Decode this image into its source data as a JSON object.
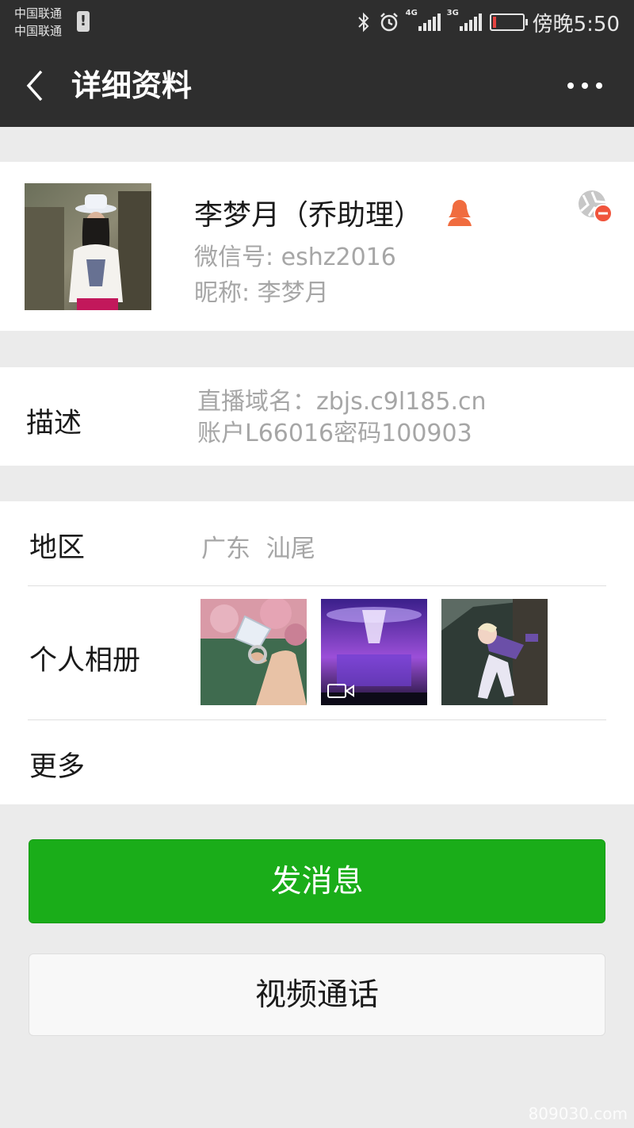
{
  "status_bar": {
    "carrier_1": "中国联通",
    "carrier_2": "中国联通",
    "signal_tag_1": "4G",
    "signal_tag_2": "3G",
    "time": "傍晚5:50",
    "battery_fraction": 0.1,
    "battery_color": "#e64340"
  },
  "nav": {
    "title": "详细资料",
    "back_icon": "chevron-left-icon",
    "more_icon": "more-dots-icon"
  },
  "profile": {
    "name": "李梦月（乔助理）",
    "wechat_id": "微信号: eshz2016",
    "nickname": "昵称: 李梦月",
    "gender_icon": "female-person-icon",
    "gender_icon_color": "#f06c3f",
    "privacy_icon": "hide-moments-icon"
  },
  "description": {
    "label": "描述",
    "line1": "直播域名：zbjs.c9l185.cn",
    "line2": "账户L66016密码100903"
  },
  "region": {
    "label": "地区",
    "value": "广东  汕尾"
  },
  "album": {
    "label": "个人相册",
    "photos": [
      "ring-photo",
      "stage-video-photo",
      "dancer-photo"
    ]
  },
  "more": {
    "label": "更多"
  },
  "actions": {
    "send_message": "发消息",
    "video_call": "视频通话",
    "primary_color": "#1aad19"
  },
  "watermark": "809030.com"
}
